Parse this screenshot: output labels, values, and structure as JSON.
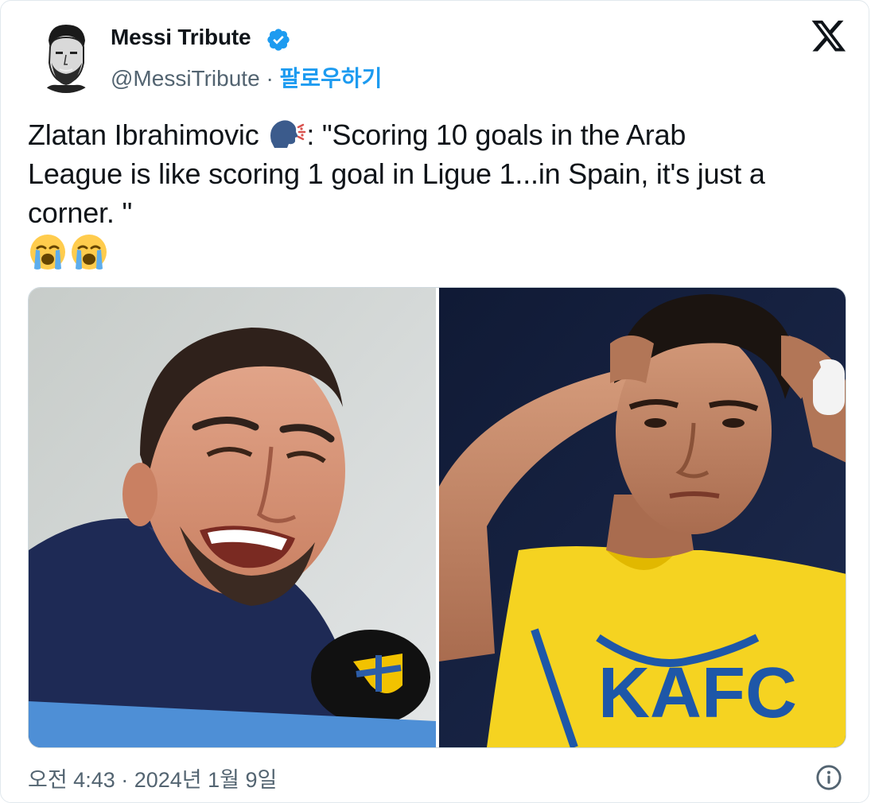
{
  "author": {
    "name": "Messi Tribute",
    "handle": "@MessiTribute",
    "separator": "·",
    "follow_label": "팔로우하기",
    "verified": true
  },
  "tweet": {
    "line1_before_emoji": "Zlatan Ibrahimovic ",
    "line1_after_emoji": ": \"Scoring 10 goals in the Arab",
    "line2": "League is like scoring 1 goal in Ligue 1...in Spain, it's just a",
    "line3": "corner. \"",
    "emojis": [
      "speaking-head-icon",
      "loudly-crying-face-icon",
      "loudly-crying-face-icon"
    ]
  },
  "media": {
    "photos": [
      {
        "subject": "zlatan-ibrahimovic-smiling-at-microphone"
      },
      {
        "subject": "cristiano-ronaldo-in-yellow-kit"
      }
    ]
  },
  "footer": {
    "timestamp": "오전 4:43 · 2024년 1월 9일"
  },
  "colors": {
    "accent": "#1d9bf0",
    "text": "#0f1419",
    "secondary": "#536471",
    "border": "#cfd9de"
  },
  "icons": {
    "brand": "x-logo-icon",
    "verified": "verified-badge-icon",
    "info": "info-icon"
  }
}
